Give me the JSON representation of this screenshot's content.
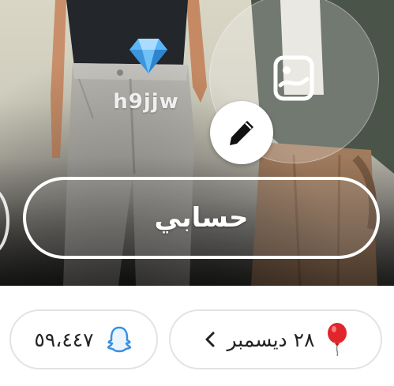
{
  "profile": {
    "username": "h9jjw",
    "account_button_label": "حسابي"
  },
  "stats": {
    "snap_score": "٥٩،٤٤٧",
    "birthday": "٢٨ ديسمبر"
  },
  "icons": {
    "diamond": "diamond-icon",
    "photo": "photo-icon",
    "edit": "pencil-icon",
    "ghost": "ghost-icon",
    "balloon": "balloon-icon",
    "chevron": "chevron-left-icon"
  },
  "colors": {
    "balloon_red": "#e0262b",
    "ghost_blue": "#3a8fe0",
    "diamond_blue": "#5ab6f5"
  }
}
